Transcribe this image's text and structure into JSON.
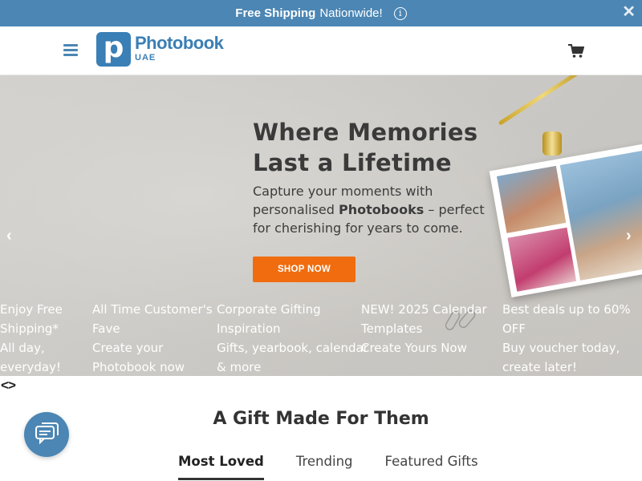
{
  "banner": {
    "bold": "Free Shipping",
    "text": "Nationwide!",
    "info_glyph": "i",
    "close_glyph": "✕"
  },
  "header": {
    "logo_letter": "p",
    "logo_name": "Photobook",
    "logo_region": "UAE"
  },
  "hero": {
    "headline_line1": "Where Memories",
    "headline_line2": "Last a Lifetime",
    "desc_part1": "Capture your moments with personalised ",
    "desc_bold": "Photobooks",
    "desc_part2": " – perfect for cherishing for years to come.",
    "cta": "SHOP NOW",
    "prev_glyph": "‹",
    "next_glyph": "›"
  },
  "promos": [
    {
      "lines": [
        "Enjoy Free",
        "Shipping*",
        "All day,",
        "everyday!"
      ]
    },
    {
      "lines": [
        "All Time Customer's",
        "Fave ",
        "Create your",
        "Photobook now"
      ]
    },
    {
      "lines": [
        "Corporate Gifting",
        "Inspiration",
        "Gifts, yearbook, calendar",
        "& more"
      ]
    },
    {
      "lines": [
        "NEW! 2025 Calendar",
        "Templates",
        "Create Yours Now",
        ""
      ]
    },
    {
      "lines": [
        "Best deals up to 60%",
        "OFF ",
        "Buy voucher today,",
        "create later!"
      ]
    }
  ],
  "promo_nav": {
    "prev": "<",
    "next": ">"
  },
  "section": {
    "title": "A Gift Made For Them"
  },
  "tabs": [
    "Most Loved",
    "Trending",
    "Featured Gifts"
  ],
  "colors": {
    "brand": "#4b86b4",
    "cta": "#f06c0e"
  }
}
